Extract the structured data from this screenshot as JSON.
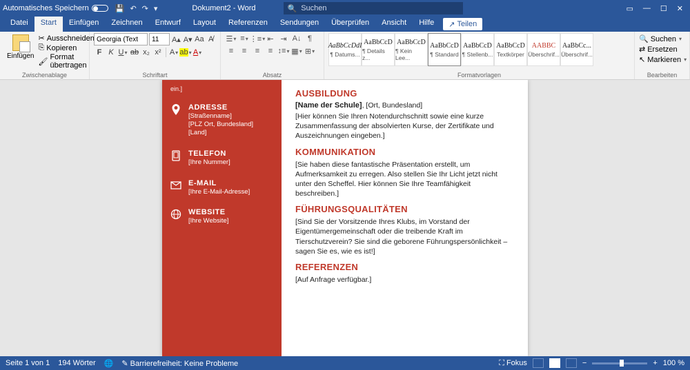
{
  "titlebar": {
    "autosave_label": "Automatisches Speichern",
    "doc_title": "Dokument2 - Word",
    "search_placeholder": "Suchen"
  },
  "tabs": {
    "datei": "Datei",
    "start": "Start",
    "einfuegen": "Einfügen",
    "zeichnen": "Zeichnen",
    "entwurf": "Entwurf",
    "layout": "Layout",
    "referenzen": "Referenzen",
    "sendungen": "Sendungen",
    "ueberpruefen": "Überprüfen",
    "ansicht": "Ansicht",
    "hilfe": "Hilfe",
    "teilen": "Teilen"
  },
  "ribbon": {
    "paste": "Einfügen",
    "cut": "Ausschneiden",
    "copy": "Kopieren",
    "format_painter": "Format übertragen",
    "group_clipboard": "Zwischenablage",
    "font_name": "Georgia (Text",
    "font_size": "11",
    "group_font": "Schriftart",
    "group_para": "Absatz",
    "styles": [
      {
        "sample": "AaBbCcDdI",
        "label": "¶ Datums...",
        "color": "#222",
        "italic": true
      },
      {
        "sample": "AaBbCcD",
        "label": "¶ Details z...",
        "color": "#222"
      },
      {
        "sample": "AaBbCcD",
        "label": "¶ Kein Lee...",
        "color": "#222"
      },
      {
        "sample": "AaBbCcD",
        "label": "¶ Standard",
        "color": "#222",
        "selected": true
      },
      {
        "sample": "AaBbCcD",
        "label": "¶ Stellenb...",
        "color": "#222"
      },
      {
        "sample": "AaBbCcD",
        "label": "Textkörper",
        "color": "#222"
      },
      {
        "sample": "AABBC",
        "label": "Überschrif...",
        "color": "#c0392b"
      },
      {
        "sample": "AaBbCc...",
        "label": "Überschrif...",
        "color": "#222"
      }
    ],
    "group_styles": "Formatvorlagen",
    "find": "Suchen",
    "replace": "Ersetzen",
    "select": "Markieren",
    "group_edit": "Bearbeiten"
  },
  "doc": {
    "cutoff": "ein.]",
    "sidebar": [
      {
        "title": "ADRESSE",
        "lines": [
          "[Straßenname]",
          "[PLZ Ort, Bundesland]",
          "[Land]"
        ]
      },
      {
        "title": "TELEFON",
        "lines": [
          "[Ihre Nummer]"
        ]
      },
      {
        "title": "E-MAIL",
        "lines": [
          "[Ihre E-Mail-Adresse]"
        ]
      },
      {
        "title": "WEBSITE",
        "lines": [
          "[Ihre Website]"
        ]
      }
    ],
    "sections": [
      {
        "heading": "AUSBILDUNG",
        "bold_lead": "[Name der Schule]",
        "bold_tail": ", [Ort, Bundesland]",
        "body": "[Hier können Sie Ihren Notendurchschnitt sowie eine kurze Zusammenfassung der absolvierten Kurse, der Zertifikate und Auszeichnungen eingeben.]"
      },
      {
        "heading": "KOMMUNIKATION",
        "body": "[Sie haben diese fantastische Präsentation erstellt, um Aufmerksamkeit zu erregen. Also stellen Sie Ihr Licht jetzt nicht unter den Scheffel. Hier können Sie Ihre Teamfähigkeit beschreiben.]"
      },
      {
        "heading": "FÜHRUNGSQUALITÄTEN",
        "body": "[Sind Sie der Vorsitzende Ihres Klubs, im Vorstand der Eigentümergemeinschaft oder die treibende Kraft im Tierschutzverein? Sie sind die geborene Führungspersönlichkeit – sagen Sie es, wie es ist!]"
      },
      {
        "heading": "REFERENZEN",
        "body": "[Auf Anfrage verfügbar.]"
      }
    ]
  },
  "status": {
    "page": "Seite 1 von 1",
    "words": "194 Wörter",
    "lang_icon": "",
    "a11y": "Barrierefreiheit: Keine Probleme",
    "focus": "Fokus",
    "zoom": "100 %"
  }
}
